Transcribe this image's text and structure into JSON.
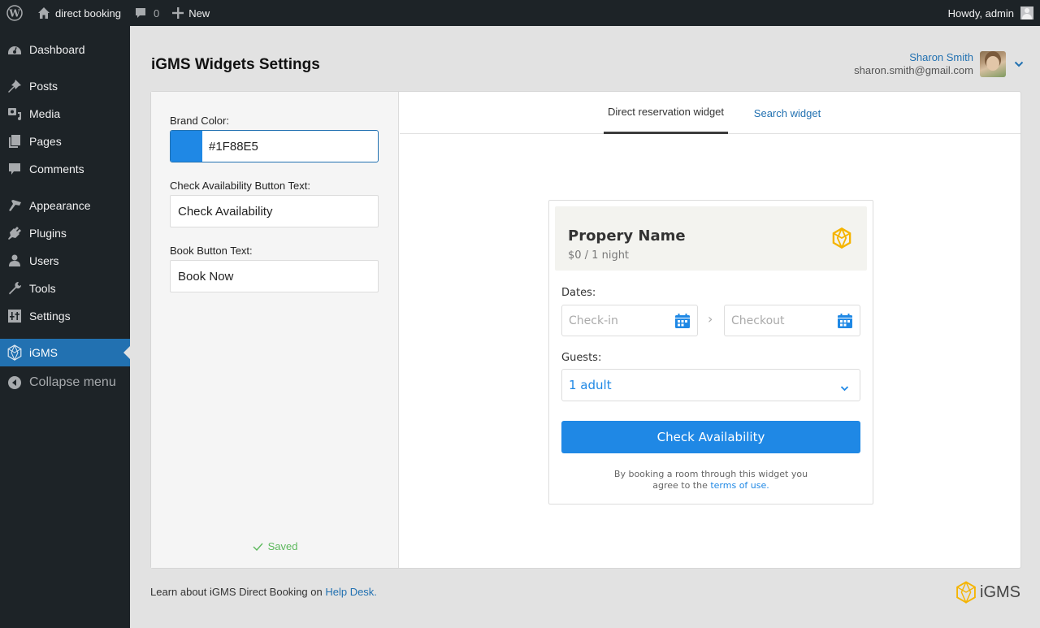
{
  "adminbar": {
    "site_name": "direct booking",
    "comments_count": "0",
    "new_label": "New",
    "greeting": "Howdy, admin"
  },
  "sidebar": {
    "items": [
      {
        "label": "Dashboard",
        "icon": "dashboard-icon"
      },
      {
        "label": "Posts",
        "icon": "pin-icon"
      },
      {
        "label": "Media",
        "icon": "media-icon"
      },
      {
        "label": "Pages",
        "icon": "pages-icon"
      },
      {
        "label": "Comments",
        "icon": "comment-icon"
      },
      {
        "label": "Appearance",
        "icon": "paintbrush-icon"
      },
      {
        "label": "Plugins",
        "icon": "plugin-icon"
      },
      {
        "label": "Users",
        "icon": "user-icon"
      },
      {
        "label": "Tools",
        "icon": "wrench-icon"
      },
      {
        "label": "Settings",
        "icon": "settings-icon"
      },
      {
        "label": "iGMS",
        "icon": "igms-icon",
        "active": true
      },
      {
        "label": "Collapse menu",
        "icon": "collapse-icon"
      }
    ]
  },
  "header": {
    "title": "iGMS Widgets Settings",
    "user_name": "Sharon Smith",
    "user_email": "sharon.smith@gmail.com"
  },
  "settings": {
    "brand_color_label": "Brand Color:",
    "brand_color_value": "#1F88E5",
    "check_label": "Check Availability Button Text:",
    "check_value": "Check Availability",
    "book_label": "Book Button Text:",
    "book_value": "Book Now",
    "status": "Saved"
  },
  "tabs": [
    {
      "label": "Direct reservation widget",
      "active": true
    },
    {
      "label": "Search widget",
      "active": false
    }
  ],
  "widget": {
    "property_name": "Propery Name",
    "price": "$0 / 1 night",
    "dates_label": "Dates:",
    "checkin_placeholder": "Check-in",
    "checkout_placeholder": "Checkout",
    "guests_label": "Guests:",
    "guests_value": "1 adult",
    "button_label": "Check Availability",
    "terms_text_1": "By booking a room through this widget you",
    "terms_text_2": "agree to the ",
    "terms_link": "terms of use.",
    "accent_color": "#1F88E5",
    "logo_color": "#F5B400"
  },
  "footer": {
    "text": "Learn about iGMS Direct Booking on ",
    "link": "Help Desk.",
    "brand": "iGMS"
  }
}
